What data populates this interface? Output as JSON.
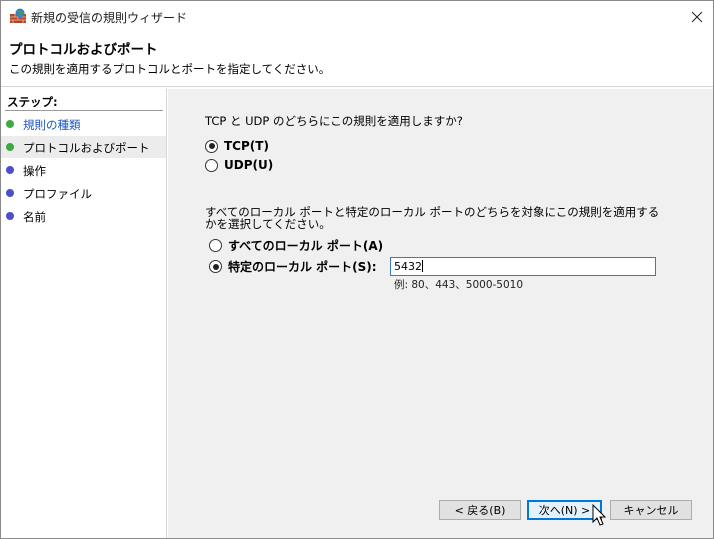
{
  "window": {
    "title": "新規の受信の規則ウィザード"
  },
  "header": {
    "title": "プロトコルおよびポート",
    "description": "この規則を適用するプロトコルとポートを指定してください。"
  },
  "sidebar": {
    "steps_label": "ステップ:",
    "items": [
      {
        "label": "規則の種類",
        "state": "done",
        "dot_color": "#3fa93f",
        "text_color": "#1a56c4"
      },
      {
        "label": "プロトコルおよびポート",
        "state": "current",
        "dot_color": "#3fa93f",
        "text_color": "#000000"
      },
      {
        "label": "操作",
        "state": "pending",
        "dot_color": "#4b4fc9",
        "text_color": "#000000"
      },
      {
        "label": "プロファイル",
        "state": "pending",
        "dot_color": "#4b4fc9",
        "text_color": "#000000"
      },
      {
        "label": "名前",
        "state": "pending",
        "dot_color": "#4b4fc9",
        "text_color": "#000000"
      }
    ]
  },
  "protocol": {
    "question": "TCP と UDP のどちらにこの規則を適用しますか?",
    "options": [
      {
        "label": "TCP(T)",
        "checked": true
      },
      {
        "label": "UDP(U)",
        "checked": false
      }
    ]
  },
  "ports": {
    "question": "すべてのローカル ポートと特定のローカル ポートのどちらを対象にこの規則を適用するかを選択してください。",
    "options": [
      {
        "label": "すべてのローカル ポート(A)",
        "checked": false
      },
      {
        "label": "特定のローカル ポート(S):",
        "checked": true
      }
    ],
    "value": "5432",
    "example": "例: 80、443、5000-5010"
  },
  "buttons": {
    "back": "< 戻る(B)",
    "next": "次へ(N) >",
    "cancel": "キャンセル"
  },
  "colors": {
    "accent": "#0078d7",
    "main_bg": "#f0f0f0",
    "link_blue": "#1a56c4"
  }
}
